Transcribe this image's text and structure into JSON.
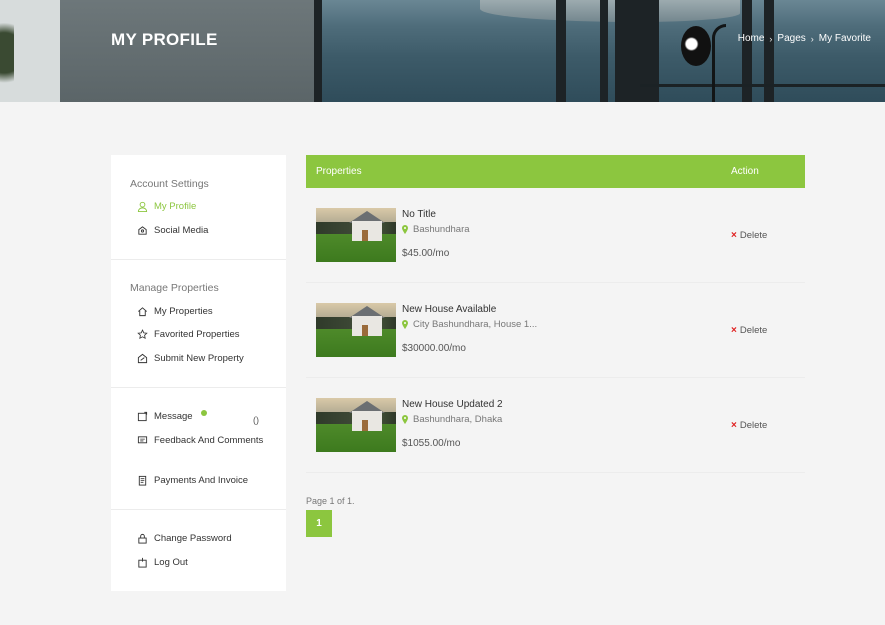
{
  "header": {
    "title": "MY PROFILE",
    "breadcrumb": [
      "Home",
      "Pages",
      "My Favorite"
    ]
  },
  "sidebar": {
    "account": {
      "title": "Account Settings",
      "items": [
        {
          "label": "My Profile",
          "icon": "user-icon",
          "active": true
        },
        {
          "label": "Social Media",
          "icon": "social-icon"
        }
      ]
    },
    "properties": {
      "title": "Manage Properties",
      "items": [
        {
          "label": "My Properties",
          "icon": "home-icon"
        },
        {
          "label": "Favorited Properties",
          "icon": "star-icon"
        },
        {
          "label": "Submit New Property",
          "icon": "submit-icon"
        }
      ]
    },
    "communication": {
      "items": [
        {
          "label": "Message",
          "icon": "message-icon",
          "count": "()"
        },
        {
          "label": "Feedback And Comments",
          "icon": "feedback-icon"
        },
        {
          "label": "Payments And Invoice",
          "icon": "invoice-icon"
        }
      ]
    },
    "security": {
      "items": [
        {
          "label": "Change Password",
          "icon": "lock-icon"
        },
        {
          "label": "Log Out",
          "icon": "logout-icon"
        }
      ]
    }
  },
  "table": {
    "headers": {
      "properties": "Properties",
      "action": "Action"
    },
    "rows": [
      {
        "name": "No Title",
        "location": "Bashundhara",
        "price": "$45.00/mo",
        "action": "Delete"
      },
      {
        "name": "New House Available",
        "location": "City Bashundhara, House 1...",
        "price": "$30000.00/mo",
        "action": "Delete"
      },
      {
        "name": "New House Updated 2",
        "location": "Bashundhara, Dhaka",
        "price": "$1055.00/mo",
        "action": "Delete"
      }
    ]
  },
  "pagination": {
    "info": "Page 1 of 1.",
    "current": "1"
  },
  "colors": {
    "accent": "#8cc63f",
    "delete": "#e02020",
    "background": "#f4f4f4"
  }
}
